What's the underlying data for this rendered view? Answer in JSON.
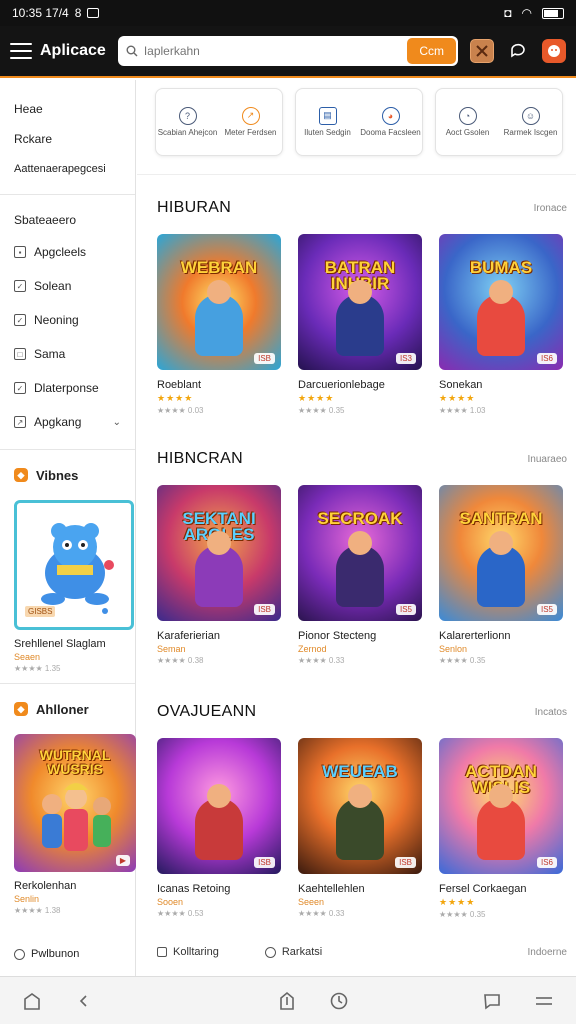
{
  "status_bar": {
    "time": "10:35 17/4",
    "indicator": "8"
  },
  "app_bar": {
    "title": "Aplicace",
    "search_placeholder": "Iaplerkahn",
    "search_button": "Ccm",
    "accent": "#f08a1c"
  },
  "quick_actions": [
    {
      "items": [
        {
          "label": "Scabian Ahejcon",
          "icon": "question-icon"
        },
        {
          "label": "Meter Ferdsen",
          "icon": "notification-icon"
        }
      ]
    },
    {
      "items": [
        {
          "label": "Iluten Sedgin",
          "icon": "chart-icon"
        },
        {
          "label": "Dooma Facsleen",
          "icon": "globe-icon"
        }
      ]
    },
    {
      "items": [
        {
          "label": "Aoct Gsolen",
          "icon": "clock-icon"
        },
        {
          "label": "Rarmek Iscgen",
          "icon": "user-icon"
        }
      ]
    }
  ],
  "sidebar": {
    "top_links": [
      "Heae",
      "Rckare",
      "Aattenaerapegcesi"
    ],
    "section_label": "Sbateaeero",
    "items": [
      {
        "label": "Apgcleels",
        "icon": "app-icon"
      },
      {
        "label": "Solean",
        "icon": "check-icon"
      },
      {
        "label": "Neoning",
        "icon": "check-icon"
      },
      {
        "label": "Sama",
        "icon": "square-icon"
      },
      {
        "label": "Dlaterponse",
        "icon": "check-icon"
      },
      {
        "label": "Apgkang",
        "icon": "external-icon",
        "has_chevron": true
      }
    ],
    "promo1": {
      "head": "Vibnes",
      "name": "Srehllenel Slaglam",
      "sub": "Seaen",
      "meta": "★★★★ 1.35",
      "tag": "GISBS"
    },
    "promo2": {
      "head": "Ahlloner",
      "name": "Rerkolenhan",
      "sub": "Senlin",
      "meta": "★★★★ 1.38",
      "title": "WUTRNAL WUSRIS"
    },
    "bottom_link": "Pwlbunon"
  },
  "sections": [
    {
      "title": "HIBURAN",
      "more": "Ironace",
      "games": [
        {
          "title": "WEBRAN",
          "name": "Roeblant",
          "stars": "★★★★",
          "meta": "★★★★ 0.03",
          "badge": "ISB"
        },
        {
          "title": "BATRAN INHBIR",
          "name": "Darcuerionlebage",
          "stars": "★★★★",
          "meta": "★★★★ 0.35",
          "badge": "IS3"
        },
        {
          "title": "BUMAS",
          "name": "Sonekan",
          "stars": "★★★★",
          "meta": "★★★★ 1.03",
          "badge": "IS6"
        }
      ]
    },
    {
      "title": "HIBNCRAN",
      "more": "Inuaraeo",
      "games": [
        {
          "title": "SEKTANI AROLES",
          "name": "Karaferierian",
          "sub": "Seman",
          "meta": "★★★★ 0.38",
          "badge": "ISB"
        },
        {
          "title": "SECROAK",
          "name": "Pionor Stecteng",
          "sub": "Zernod",
          "meta": "★★★★ 0.33",
          "badge": "IS5"
        },
        {
          "title": "SANTRAN",
          "name": "Kalarerterlionn",
          "sub": "Senlon",
          "meta": "★★★★ 0.35",
          "badge": "IS5"
        }
      ]
    },
    {
      "title": "OVAJUEANN",
      "more": "Incatos",
      "games": [
        {
          "title": "",
          "name": "Icanas Retoing",
          "sub": "Sooen",
          "meta": "★★★★ 0.53",
          "badge": "ISB"
        },
        {
          "title": "WEUEAB",
          "name": "Kaehtellehlen",
          "sub": "Seeen",
          "meta": "★★★★ 0.33",
          "badge": "ISB"
        },
        {
          "title": "ACTDAN WISLIS",
          "name": "Fersel Corkaegan",
          "stars": "★★★★",
          "meta": "★★★★ 0.35",
          "badge": "IS6"
        }
      ]
    }
  ],
  "bottom_links": [
    {
      "label": "Kolltaring",
      "icon": "image-icon"
    },
    {
      "label": "Rarkatsi",
      "icon": "clock-icon"
    }
  ],
  "bottom_more": "Indoerne"
}
